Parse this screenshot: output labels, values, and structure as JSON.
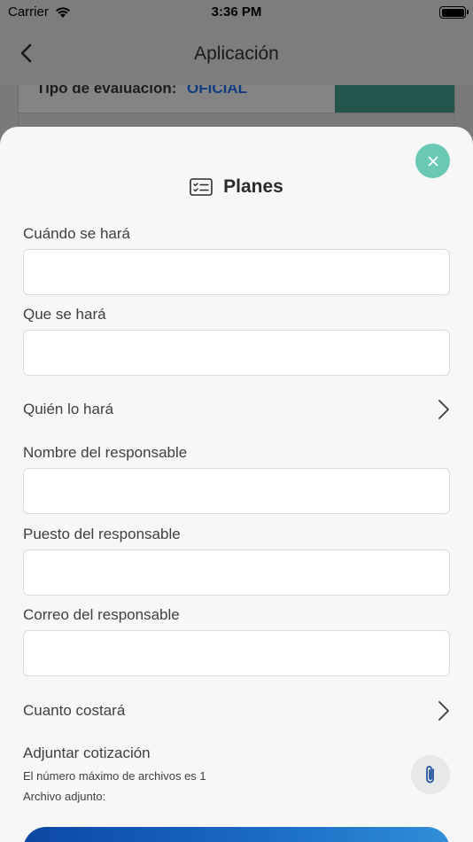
{
  "status_bar": {
    "carrier": "Carrier",
    "time": "3:36 PM"
  },
  "nav": {
    "title": "Aplicación",
    "back_icon": "chevron-left-icon"
  },
  "background": {
    "eval_label": "Tipo de evaluación:",
    "eval_value": "OFICIAL"
  },
  "sheet": {
    "title": "Planes",
    "title_icon": "checklist-card-icon",
    "close_icon": "close-icon",
    "fields": {
      "cuando": {
        "label": "Cuándo se hará",
        "value": "",
        "placeholder": ""
      },
      "que": {
        "label": "Que se hará",
        "value": "",
        "placeholder": ""
      },
      "nombre": {
        "label": "Nombre del responsable",
        "value": "",
        "placeholder": ""
      },
      "puesto": {
        "label": "Puesto del responsable",
        "value": "",
        "placeholder": ""
      },
      "correo": {
        "label": "Correo del responsable",
        "value": "",
        "placeholder": ""
      }
    },
    "pickers": {
      "quien": {
        "label": "Quién lo hará"
      },
      "costo": {
        "label": "Cuanto costará"
      }
    },
    "attachment": {
      "title": "Adjuntar cotización",
      "max_files": "El número máximo de archivos es 1",
      "attached_label": "Archivo adjunto:",
      "icon": "paperclip-icon"
    }
  },
  "colors": {
    "accent_teal": "#6ac9b5",
    "primary_blue": "#0b47a3",
    "sheet_bg": "#f7f7f7"
  }
}
